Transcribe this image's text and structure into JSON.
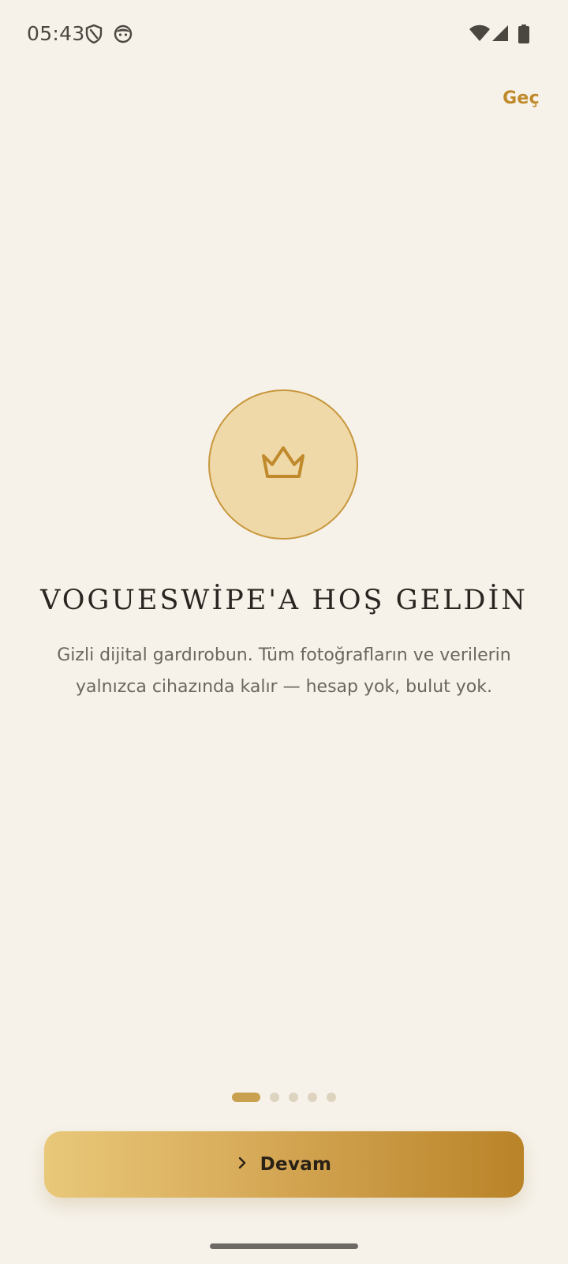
{
  "status_bar": {
    "time": "05:43",
    "icons": [
      "shield-icon",
      "face-icon",
      "wifi-icon",
      "signal-icon",
      "battery-icon"
    ]
  },
  "onboarding": {
    "skip_label": "Geç",
    "hero_icon": "crown-icon",
    "title": "VOGUESWİPE'A HOŞ GELDİN",
    "description": "Gizli dijital gardırobun. Tüm fotoğrafların ve verilerin yalnızca cihazında kalır — hesap yok, bulut yok.",
    "page_count": 5,
    "current_page": 1,
    "continue_label": "Devam",
    "continue_icon": "chevron-right-icon"
  },
  "colors": {
    "background": "#f6f2ea",
    "accent": "#c08a2c",
    "circle_fill": "#efd9a8",
    "button_gradient_start": "#e9c87a",
    "button_gradient_end": "#b98328"
  }
}
